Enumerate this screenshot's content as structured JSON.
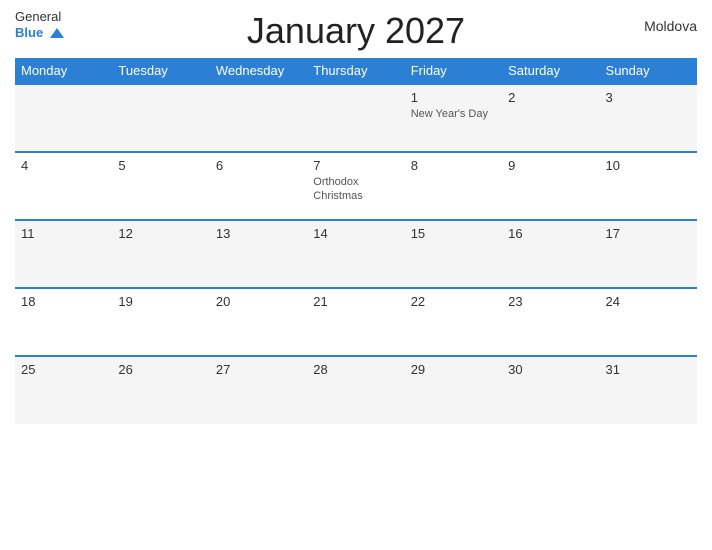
{
  "header": {
    "title": "January 2027",
    "country": "Moldova",
    "logo_general": "General",
    "logo_blue": "Blue"
  },
  "weekdays": [
    {
      "label": "Monday"
    },
    {
      "label": "Tuesday"
    },
    {
      "label": "Wednesday"
    },
    {
      "label": "Thursday"
    },
    {
      "label": "Friday"
    },
    {
      "label": "Saturday"
    },
    {
      "label": "Sunday"
    }
  ],
  "weeks": [
    {
      "days": [
        {
          "number": "",
          "holiday": ""
        },
        {
          "number": "",
          "holiday": ""
        },
        {
          "number": "",
          "holiday": ""
        },
        {
          "number": "",
          "holiday": ""
        },
        {
          "number": "1",
          "holiday": "New Year's Day"
        },
        {
          "number": "2",
          "holiday": ""
        },
        {
          "number": "3",
          "holiday": ""
        }
      ]
    },
    {
      "days": [
        {
          "number": "4",
          "holiday": ""
        },
        {
          "number": "5",
          "holiday": ""
        },
        {
          "number": "6",
          "holiday": ""
        },
        {
          "number": "7",
          "holiday": "Orthodox Christmas"
        },
        {
          "number": "8",
          "holiday": ""
        },
        {
          "number": "9",
          "holiday": ""
        },
        {
          "number": "10",
          "holiday": ""
        }
      ]
    },
    {
      "days": [
        {
          "number": "11",
          "holiday": ""
        },
        {
          "number": "12",
          "holiday": ""
        },
        {
          "number": "13",
          "holiday": ""
        },
        {
          "number": "14",
          "holiday": ""
        },
        {
          "number": "15",
          "holiday": ""
        },
        {
          "number": "16",
          "holiday": ""
        },
        {
          "number": "17",
          "holiday": ""
        }
      ]
    },
    {
      "days": [
        {
          "number": "18",
          "holiday": ""
        },
        {
          "number": "19",
          "holiday": ""
        },
        {
          "number": "20",
          "holiday": ""
        },
        {
          "number": "21",
          "holiday": ""
        },
        {
          "number": "22",
          "holiday": ""
        },
        {
          "number": "23",
          "holiday": ""
        },
        {
          "number": "24",
          "holiday": ""
        }
      ]
    },
    {
      "days": [
        {
          "number": "25",
          "holiday": ""
        },
        {
          "number": "26",
          "holiday": ""
        },
        {
          "number": "27",
          "holiday": ""
        },
        {
          "number": "28",
          "holiday": ""
        },
        {
          "number": "29",
          "holiday": ""
        },
        {
          "number": "30",
          "holiday": ""
        },
        {
          "number": "31",
          "holiday": ""
        }
      ]
    }
  ]
}
